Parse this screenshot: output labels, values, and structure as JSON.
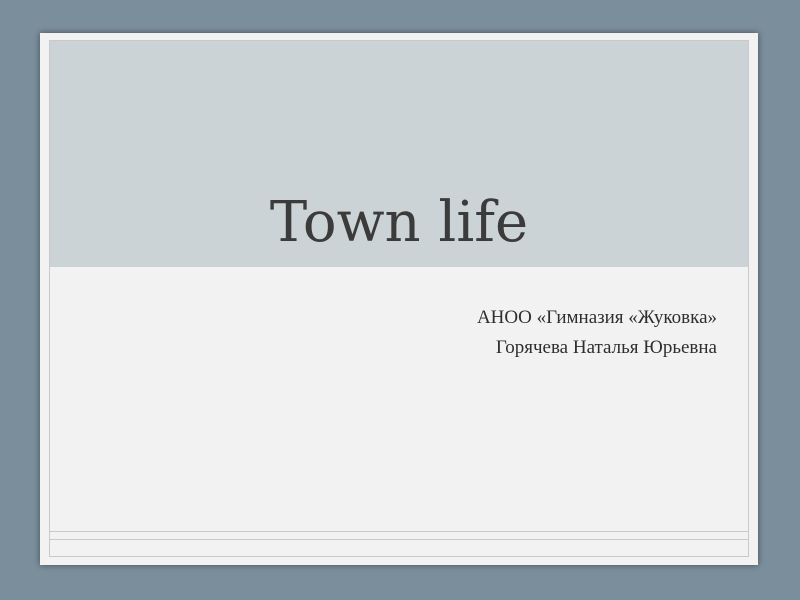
{
  "slide": {
    "title": "Town life",
    "subtitle_lines": [
      "АНОО «Гимназия «Жуковка»",
      "Горячева Наталья Юрьевна"
    ]
  },
  "colors": {
    "background": "#7b8e9c",
    "slide": "#f2f2f2",
    "title_band": "#ccd3d6",
    "text": "#3b3b3b"
  }
}
